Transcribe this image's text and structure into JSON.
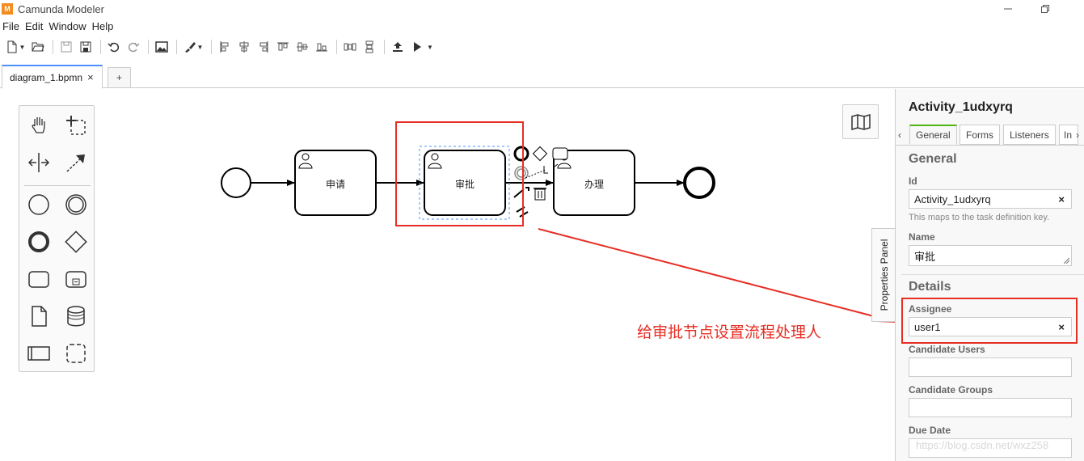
{
  "window": {
    "title": "Camunda Modeler",
    "logo_text": "M"
  },
  "menu": {
    "items": [
      "File",
      "Edit",
      "Window",
      "Help"
    ]
  },
  "tabs": {
    "active_label": "diagram_1.bpmn",
    "close_glyph": "×",
    "add_glyph": "+"
  },
  "diagram": {
    "tasks": [
      "申请",
      "审批",
      "办理"
    ]
  },
  "annotation": {
    "text": "给审批节点设置流程处理人",
    "color": "#e62e24"
  },
  "properties": {
    "toggle_label": "Properties Panel",
    "element_id": "Activity_1udxyrq",
    "tabs": [
      "General",
      "Forms",
      "Listeners",
      "In"
    ],
    "prev_glyph": "‹",
    "next_glyph": "›",
    "general": {
      "title": "General",
      "id_label": "Id",
      "id_value": "Activity_1udxyrq",
      "id_hint": "This maps to the task definition key.",
      "name_label": "Name",
      "name_value": "审批"
    },
    "details": {
      "title": "Details",
      "assignee_label": "Assignee",
      "assignee_value": "user1",
      "candidate_users_label": "Candidate Users",
      "candidate_groups_label": "Candidate Groups",
      "due_date_label": "Due Date"
    },
    "clear_glyph": "×"
  },
  "watermark": "https://blog.csdn.net/wxz258",
  "colors": {
    "accent_tab": "#4d90fe",
    "properties_active_tab": "#52b415",
    "highlight": "#e62e24",
    "selection_dash": "#4d90fe"
  }
}
